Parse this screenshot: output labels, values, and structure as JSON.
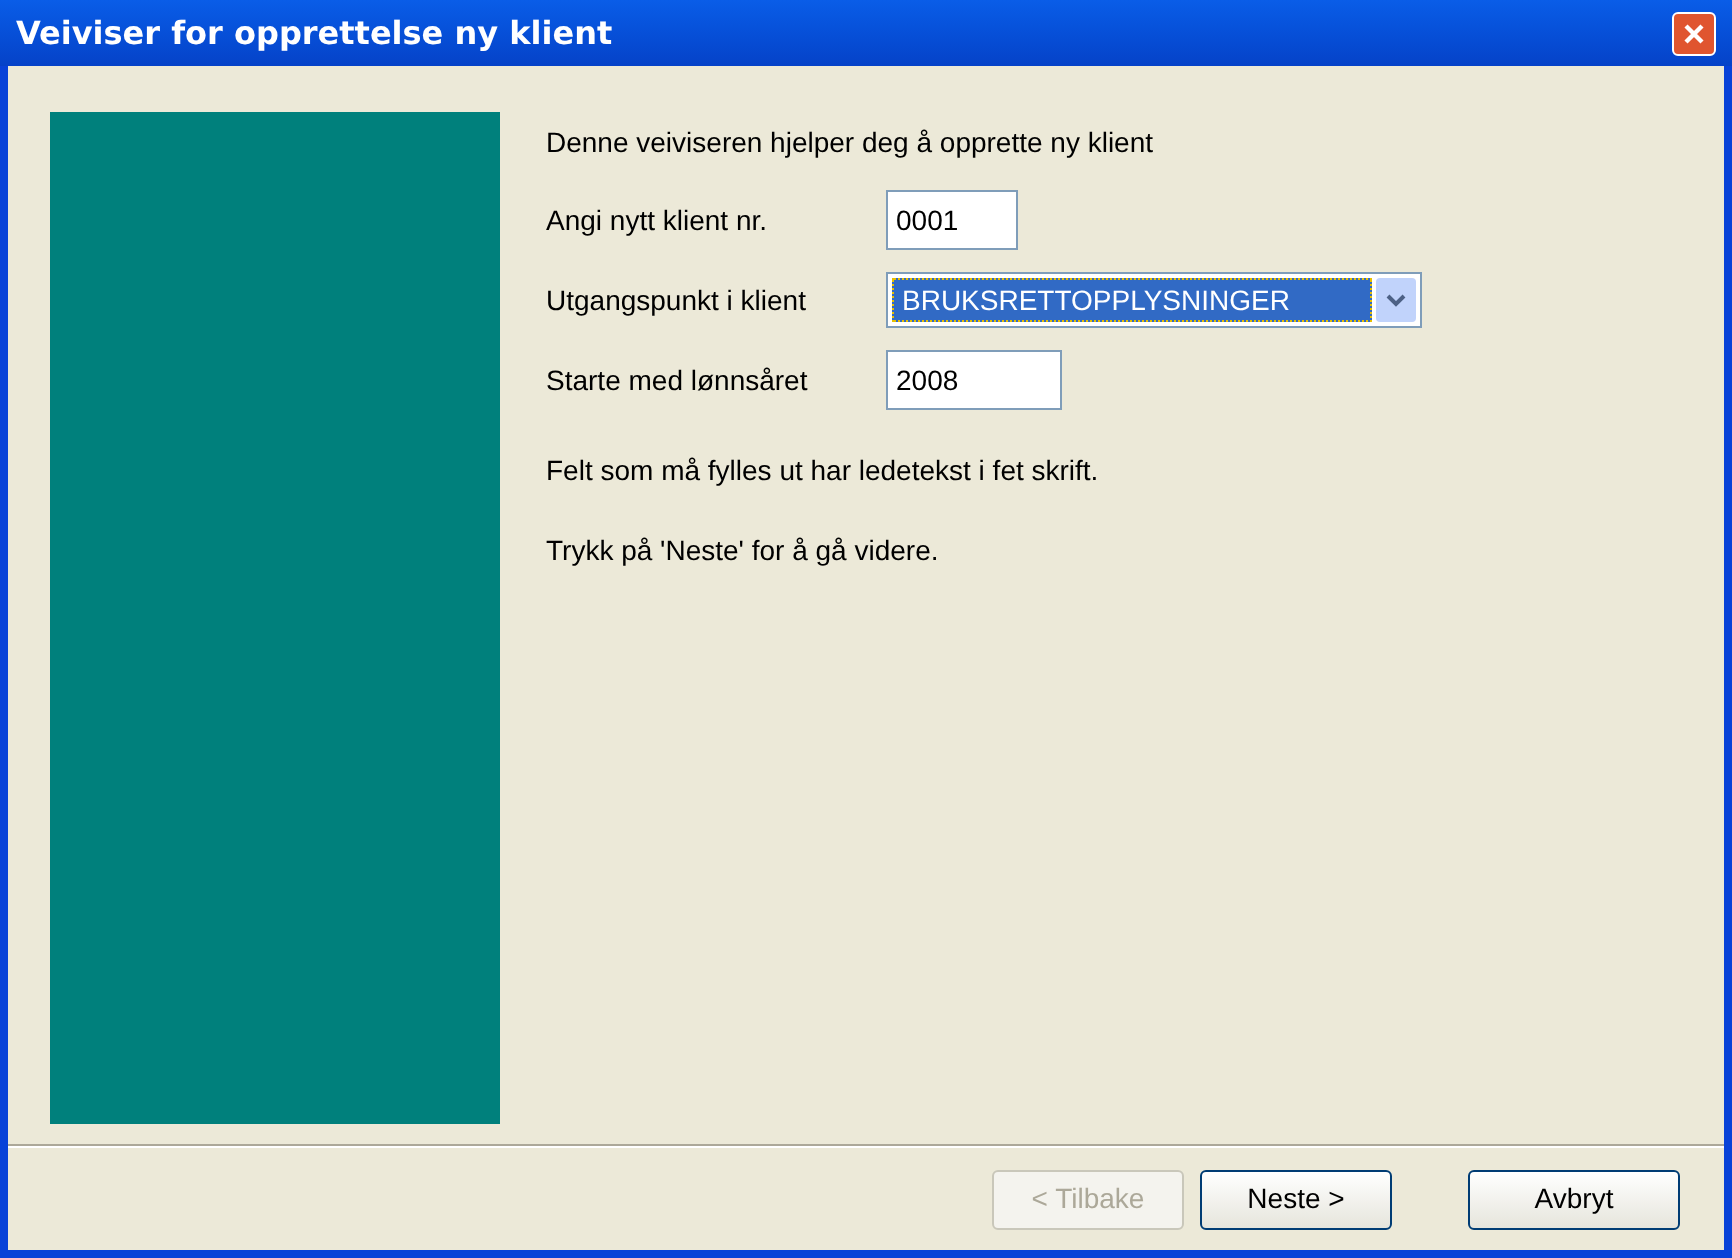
{
  "window": {
    "title": "Veiviser for opprettelse ny klient"
  },
  "intro": "Denne veiviseren hjelper deg å opprette ny klient",
  "fields": [
    {
      "kind": "text",
      "label": "Angi nytt klient nr.",
      "value": "0001"
    },
    {
      "kind": "combo",
      "label": "Utgangspunkt i klient",
      "value": "BRUKSRETTOPPLYSNINGER"
    },
    {
      "kind": "text",
      "label": "Starte med lønnsåret",
      "value": "2008"
    }
  ],
  "notes": [
    "Felt som må fylles ut har ledetekst i fet skrift.",
    "Trykk på 'Neste' for å gå videre."
  ],
  "buttons": [
    {
      "label": "< Tilbake",
      "disabled": true
    },
    {
      "label": "Neste >",
      "disabled": false
    },
    {
      "label": "Avbryt",
      "disabled": false
    }
  ]
}
